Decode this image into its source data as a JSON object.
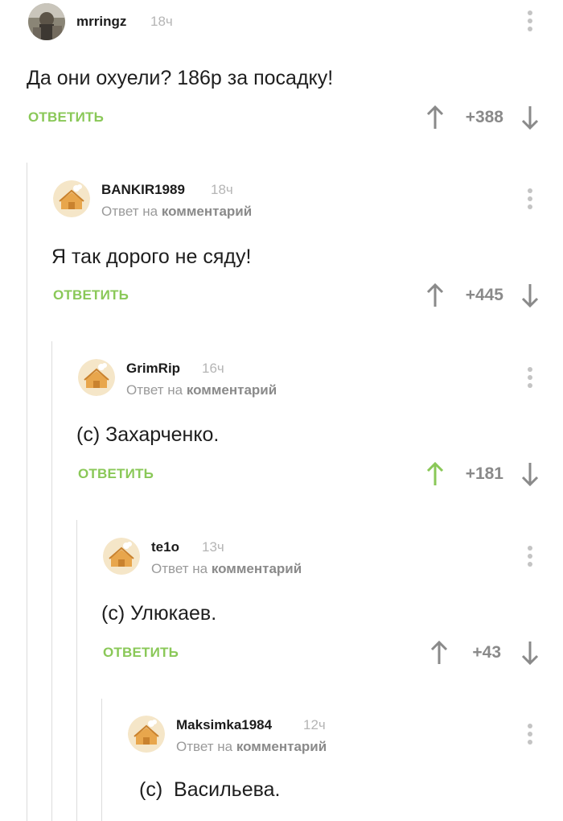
{
  "colors": {
    "accent_green": "#8ac858",
    "muted_text": "#9a9a9a",
    "thread_line": "#dcdcdc"
  },
  "comments": [
    {
      "username": "mrringz",
      "time": "18ч",
      "reply_prefix": "",
      "reply_target": "",
      "text": "Да они охуели? 186р за посадку!",
      "reply_label": "ОТВЕТИТЬ",
      "rating": "+388",
      "upvoted": false,
      "avatar_icon": "photo-avatar-icon"
    },
    {
      "username": "BANKIR1989",
      "time": "18ч",
      "reply_prefix": "Ответ на",
      "reply_target": "комментарий",
      "text": "Я так дорого не сяду!",
      "reply_label": "ОТВЕТИТЬ",
      "rating": "+445",
      "upvoted": false,
      "avatar_icon": "house-avatar-icon"
    },
    {
      "username": "GrimRip",
      "time": "16ч",
      "reply_prefix": "Ответ на",
      "reply_target": "комментарий",
      "text": "(с) Захарченко.",
      "reply_label": "ОТВЕТИТЬ",
      "rating": "+181",
      "upvoted": true,
      "avatar_icon": "house-avatar-icon"
    },
    {
      "username": "te1o",
      "time": "13ч",
      "reply_prefix": "Ответ на",
      "reply_target": "комментарий",
      "text": "(с) Улюкаев.",
      "reply_label": "ОТВЕТИТЬ",
      "rating": "+43",
      "upvoted": false,
      "avatar_icon": "house-avatar-icon"
    },
    {
      "username": "Maksimka1984",
      "time": "12ч",
      "reply_prefix": "Ответ на",
      "reply_target": "комментарий",
      "text": "(с)  Васильева.",
      "reply_label": "",
      "rating": "",
      "upvoted": false,
      "avatar_icon": "house-avatar-icon"
    }
  ]
}
